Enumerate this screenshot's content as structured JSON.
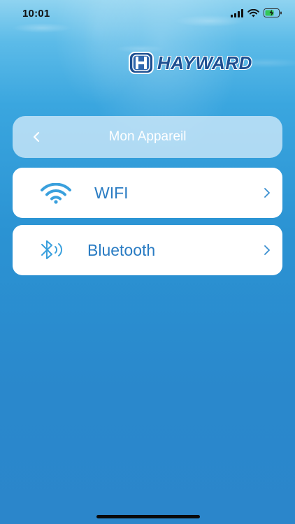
{
  "status_bar": {
    "time": "10:01"
  },
  "logo": {
    "brand": "HAYWARD"
  },
  "header": {
    "title": "Mon Appareil"
  },
  "menu": {
    "items": [
      {
        "label": "WIFI",
        "icon": "wifi-icon"
      },
      {
        "label": "Bluetooth",
        "icon": "bluetooth-icon"
      }
    ]
  },
  "colors": {
    "accent": "#2a7cc3",
    "brand": "#1d4f91",
    "battery": "#34c759"
  }
}
